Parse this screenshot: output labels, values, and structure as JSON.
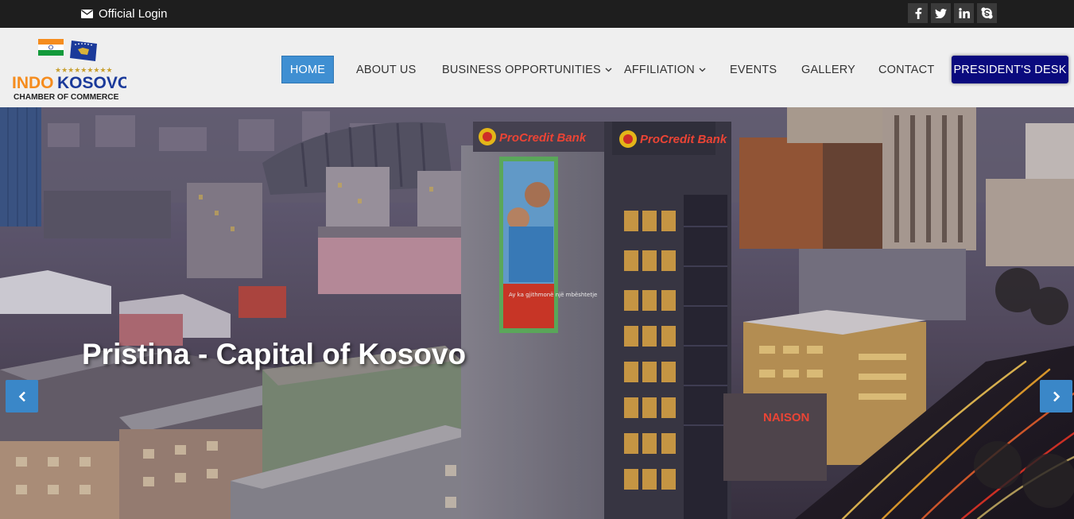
{
  "topbar": {
    "login_label": "Official Login",
    "social": [
      {
        "icon": "facebook-icon",
        "glyph": "f"
      },
      {
        "icon": "twitter-icon",
        "glyph": "t"
      },
      {
        "icon": "linkedin-icon",
        "glyph": "in"
      },
      {
        "icon": "skype-icon",
        "glyph": "S"
      }
    ]
  },
  "logo": {
    "line1_part1": "INDO",
    "line1_part2": "KOSOVO",
    "line2": "CHAMBER OF COMMERCE"
  },
  "nav": {
    "home": "HOME",
    "about": "ABOUT US",
    "business": "BUSINESS OPPORTUNITIES",
    "affiliation": "AFFILIATION",
    "events": "EVENTS",
    "gallery": "GALLERY",
    "contact": "CONTACT",
    "president": "PRESIDENT'S DESK"
  },
  "hero": {
    "caption": "Pristina - Capital of Kosovo",
    "sign_text": "ProCredit Bank",
    "billboard_text": "Ay ka gjithmonë një mbështetje"
  },
  "colors": {
    "topbar": "#1e1e1e",
    "header": "#efefef",
    "nav_active": "#3f8fd2",
    "president_button": "#0a0a7e",
    "slider_arrow": "#3a87c8"
  }
}
